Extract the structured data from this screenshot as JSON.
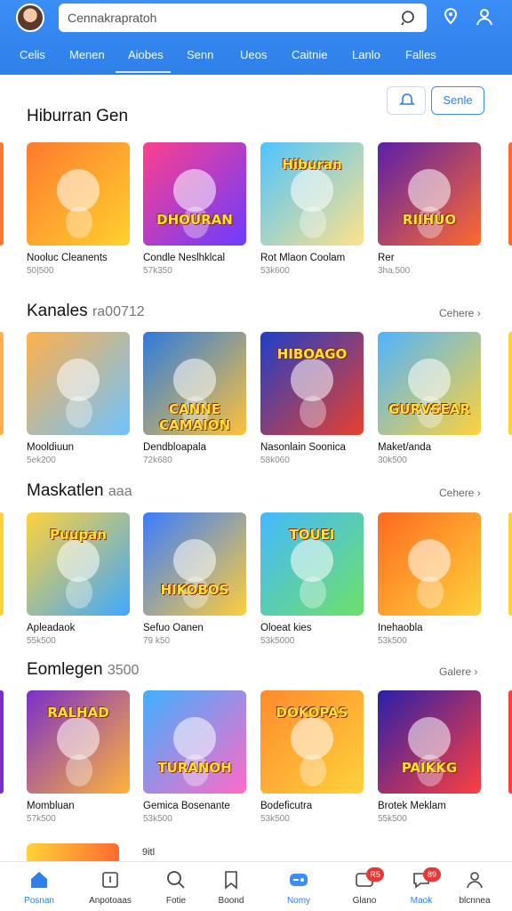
{
  "header": {
    "search_placeholder": "Cennakrapratoh",
    "tabs": [
      "Celis",
      "Menen",
      "Aiobes",
      "Senn",
      "Ueos",
      "Caitnie",
      "Lanlo",
      "Falles"
    ]
  },
  "actions": {
    "primary_label": "Senle"
  },
  "sections": [
    {
      "title": "Hiburran Gen",
      "subtitle": "",
      "see_all": "",
      "cards": [
        {
          "name": "Nooluc Cleanents",
          "meta": "50|500",
          "art_text": "",
          "colors": [
            "#ff7a2e",
            "#ffd12e"
          ]
        },
        {
          "name": "Condle Neslhklcal",
          "meta": "57k350",
          "art_text": "DHOURAN",
          "colors": [
            "#ff3f8e",
            "#6a3cff"
          ]
        },
        {
          "name": "Rot Mlaon Coolam",
          "meta": "53k600",
          "art_text": "Hiburan",
          "colors": [
            "#4ec4ff",
            "#ffe28a"
          ]
        },
        {
          "name": "Rer",
          "meta": "3ha,500",
          "art_text": "RIIHUO",
          "colors": [
            "#5b1fa8",
            "#ff6a2e"
          ]
        }
      ]
    },
    {
      "title": "Kanales",
      "subtitle": "ra00712",
      "see_all": "Cehere",
      "cards": [
        {
          "name": "Mooldiuun",
          "meta": "5ek200",
          "art_text": "",
          "colors": [
            "#ffb04a",
            "#6fc3ff"
          ]
        },
        {
          "name": "Dendbloapala",
          "meta": "72k680",
          "art_text": "CANNE CAMAION",
          "colors": [
            "#2c7be0",
            "#ffc23a"
          ]
        },
        {
          "name": "Nasonlain Soonica",
          "meta": "58k060",
          "art_text": "HIBOAGO",
          "colors": [
            "#1f3fc8",
            "#e8402e"
          ]
        },
        {
          "name": "Maket/anda",
          "meta": "30k500",
          "art_text": "GURVSEAR",
          "colors": [
            "#4fb4ff",
            "#ffd23a"
          ]
        }
      ]
    },
    {
      "title": "Maskatlen",
      "subtitle": "aaa",
      "see_all": "Cehere",
      "cards": [
        {
          "name": "Apleadaok",
          "meta": "55k500",
          "art_text": "Puupan",
          "colors": [
            "#ffd23a",
            "#3fa8ff"
          ]
        },
        {
          "name": "Sefuo Oanen",
          "meta": "79 k50",
          "art_text": "HIKOBOS",
          "colors": [
            "#3a7cff",
            "#ffce3a"
          ]
        },
        {
          "name": "Oloeat kies",
          "meta": "53k5000",
          "art_text": "TOUEI",
          "colors": [
            "#45b8ff",
            "#6ee06a"
          ]
        },
        {
          "name": "Inehaobla",
          "meta": "53k500",
          "art_text": "",
          "colors": [
            "#ff6a1f",
            "#ffd23a"
          ]
        }
      ]
    },
    {
      "title": "Eomlegen",
      "subtitle": "3500",
      "see_all": "Galere",
      "cards": [
        {
          "name": "Mombluan",
          "meta": "57k500",
          "art_text": "RALHAD",
          "colors": [
            "#7b2fc8",
            "#ffb43a"
          ]
        },
        {
          "name": "Gemica Bosenante",
          "meta": "53k500",
          "art_text": "TURANOH",
          "colors": [
            "#3fb0ff",
            "#ff6ac8"
          ]
        },
        {
          "name": "Bodeficutra",
          "meta": "53k500",
          "art_text": "DOKOPAS",
          "colors": [
            "#ff8a2e",
            "#ffd23a"
          ]
        },
        {
          "name": "Brotek Meklam",
          "meta": "55k500",
          "art_text": "PAIKKG",
          "colors": [
            "#2a1fa8",
            "#ff3f3f"
          ]
        }
      ]
    }
  ],
  "peek_label": "9itl",
  "bottom_nav": [
    {
      "label": "Posnan",
      "active": true,
      "badge": ""
    },
    {
      "label": "Anpotoaas",
      "active": false,
      "badge": ""
    },
    {
      "label": "Fotie",
      "active": false,
      "badge": ""
    },
    {
      "label": "Boond",
      "active": false,
      "badge": ""
    },
    {
      "label": "Nomy",
      "active": false,
      "badge": ""
    },
    {
      "label": "Glano",
      "active": false,
      "badge": "R5"
    },
    {
      "label": "Maok",
      "active": false,
      "badge": "89"
    },
    {
      "label": "blcnnea",
      "active": false,
      "badge": ""
    }
  ],
  "colors": {
    "accent": "#2f7fe9",
    "badge": "#e53935"
  }
}
